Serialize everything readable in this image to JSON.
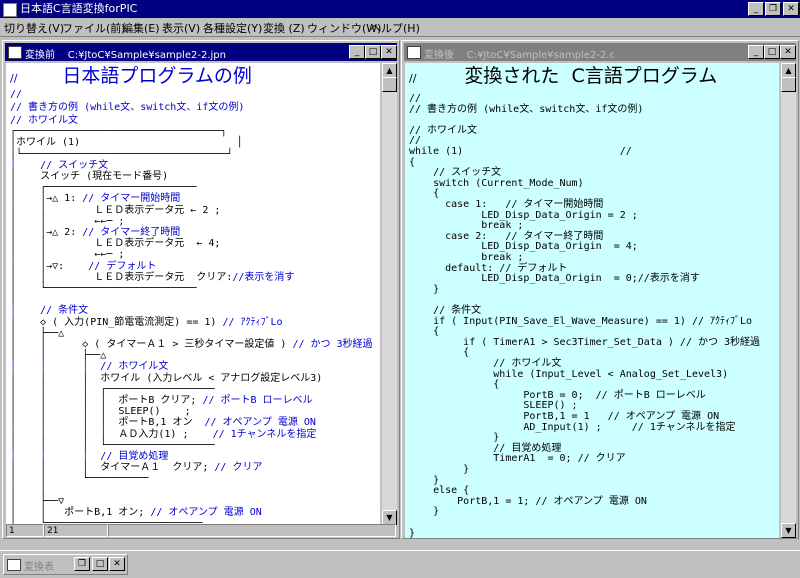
{
  "app": {
    "title": "日本語C言語変換forPIC",
    "min_glyph": "_",
    "max_glyph": "❐",
    "close_glyph": "✕"
  },
  "menu": [
    "切り替え(V)",
    "ファイル(前)",
    "編集(E)",
    "表示(V)",
    "各種設定(Y)",
    "変換 (Z)",
    "ウィンドウ(W)",
    "ヘルプ(H)"
  ],
  "left_pane": {
    "title": "変換前",
    "path": "C:¥JtoC¥Sample¥sample2-2.jpn",
    "lines": [
      {
        "t": "//",
        "c": "blue"
      },
      {
        "t": "// 書き方の例 (while文、switch文、if文の例)",
        "c": "blue"
      },
      {
        "t": "// ホワイル文",
        "c": "blue"
      },
      {
        "t": "┌──────────────────────────────────┐",
        "c": ""
      },
      {
        "t": "│ホワイル (1)                          │",
        "c": ""
      },
      {
        "t": "│└──────────────────────────────────┘",
        "c": ""
      },
      {
        "t": "│    // スイッチ文",
        "c": "blue"
      },
      {
        "t": "│    スイッチ (現在モード番号)",
        "c": ""
      },
      {
        "t": "│    ┌─────────────────────────",
        "c": ""
      },
      {
        "t": "│    │→△ 1: // タイマー開始時間",
        "c": "mix1"
      },
      {
        "t": "│    │        ＬＥＤ表示データ元 ← 2 ;",
        "c": ""
      },
      {
        "t": "│    │        ←←─ ;",
        "c": ""
      },
      {
        "t": "│    │→△ 2: // タイマー終了時間",
        "c": "mix1"
      },
      {
        "t": "│    │        ＬＥＤ表示データ元  ← 4;",
        "c": ""
      },
      {
        "t": "│    │        ←←─ ;",
        "c": ""
      },
      {
        "t": "│    │→▽:    // デフォルト",
        "c": "mix1"
      },
      {
        "t": "│    │        ＬＥＤ表示データ元  クリア://表示を消す",
        "c": "mix2"
      },
      {
        "t": "│    └─────────────────────────",
        "c": ""
      },
      {
        "t": "│",
        "c": ""
      },
      {
        "t": "│    // 条件文",
        "c": "blue"
      },
      {
        "t": "│    ◇ ( 入力(PIN_節電電流測定) == 1) // ｱｸﾃｨﾌﾞLo",
        "c": "mix3"
      },
      {
        "t": "│    ├──△",
        "c": ""
      },
      {
        "t": "│    │      ◇ ( タイマーＡ１ > 三秒タイマー設定値 ) // かつ 3秒経過",
        "c": "mix4"
      },
      {
        "t": "│    │      ├──△",
        "c": ""
      },
      {
        "t": "│    │      │  // ホワイル文",
        "c": "blue"
      },
      {
        "t": "│    │      │  ホワイル (入力レベル < アナログ設定レベル3)",
        "c": ""
      },
      {
        "t": "│    │      │  ┌──────────────────",
        "c": ""
      },
      {
        "t": "│    │      │  │  ポートB クリア; // ポートB ローレベル",
        "c": "mix5"
      },
      {
        "t": "│    │      │  │  SLEEP()    ;",
        "c": ""
      },
      {
        "t": "│    │      │  │  ポートB,1 オン  // オペアンプ 電源 ON",
        "c": "mix6"
      },
      {
        "t": "│    │      │  │  ＡＤ入力(1) ;    // 1チャンネルを指定",
        "c": "mix7"
      },
      {
        "t": "│    │      │  └──────────────────",
        "c": ""
      },
      {
        "t": "│    │      │  // 目覚め処理",
        "c": "blue"
      },
      {
        "t": "│    │      │  タイマーＡ１  クリア; // クリア",
        "c": "mix8"
      },
      {
        "t": "│    │      └──────────",
        "c": ""
      },
      {
        "t": "│    │",
        "c": ""
      },
      {
        "t": "│    ├──▽",
        "c": ""
      },
      {
        "t": "│    │   ポートB,1 オン; // オペアンプ 電源 ON",
        "c": "mix9"
      },
      {
        "t": "│    └──────────────────────────",
        "c": ""
      },
      {
        "t": "│",
        "c": ""
      },
      {
        "t": "└────────────────────────────────────",
        "c": ""
      }
    ],
    "heading": "日本語プログラムの例",
    "status": [
      "1",
      "21"
    ]
  },
  "right_pane": {
    "title": "変換後",
    "path": "C:¥JtoC¥Sample¥sample2-2.c",
    "heading": "変換された  C言語プログラム",
    "lines": [
      "//",
      "// 書き方の例 (while文、switch文、if文の例)",
      "",
      "// ホワイル文",
      "//",
      "while (1)                          //",
      "{",
      "    // スイッチ文",
      "    switch (Current_Mode_Num)",
      "    {",
      "      case 1:   // タイマー開始時間",
      "            LED_Disp_Data_Origin = 2 ;",
      "            break ;",
      "      case 2:   // タイマー終了時間",
      "            LED_Disp_Data_Origin  = 4;",
      "            break ;",
      "      default: // デフォルト",
      "            LED_Disp_Data_Origin  = 0;//表示を消す",
      "    }",
      "",
      "    // 条件文",
      "    if ( Input(PIN_Save_El_Wave_Measure) == 1) // ｱｸﾃｨﾌﾞLo",
      "    {",
      "         if ( TimerA1 > Sec3Timer_Set_Data ) // かつ 3秒経過",
      "         {",
      "              // ホワイル文",
      "              while (Input_Level < Analog_Set_Level3)",
      "              {",
      "                   PortB = 0;  // ポートB ローレベル",
      "                   SLEEP() ;",
      "                   PortB,1 = 1   // オペアンプ 電源 ON",
      "                   AD_Input(1) ;     // 1チャンネルを指定",
      "              }",
      "              // 目覚め処理",
      "              TimerA1  = 0; // クリア",
      "         }",
      "    }",
      "    else {",
      "        PortB,1 = 1; // オペアンプ 電源 ON",
      "    }",
      "",
      "}"
    ]
  },
  "taskbar": {
    "item_label": "変換表"
  }
}
